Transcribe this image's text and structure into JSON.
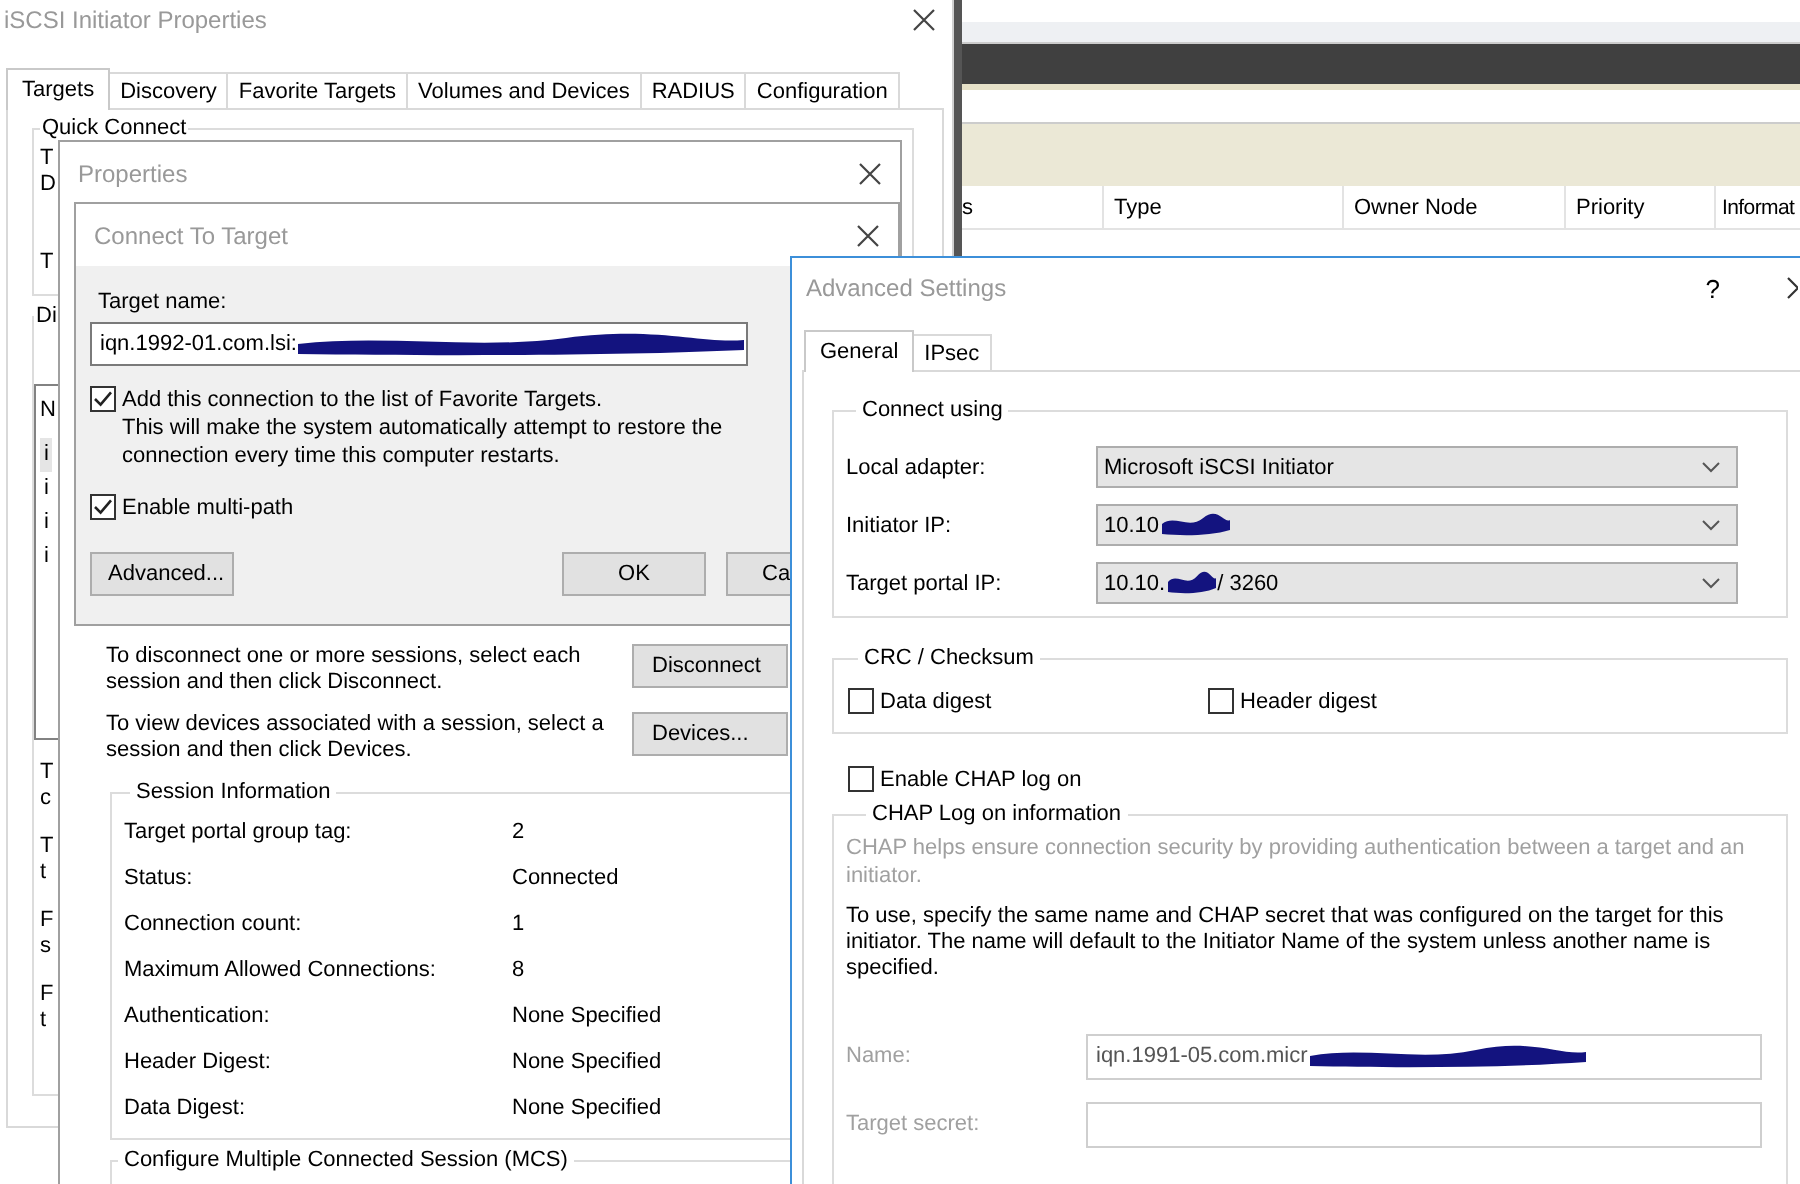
{
  "background_window": {
    "columns": [
      "s",
      "Type",
      "Owner Node",
      "Priority",
      "Informat"
    ]
  },
  "iscsi_window": {
    "title": "iSCSI Initiator Properties",
    "tabs": [
      {
        "label": "Targets",
        "selected": true
      },
      {
        "label": "Discovery",
        "selected": false
      },
      {
        "label": "Favorite Targets",
        "selected": false
      },
      {
        "label": "Volumes and Devices",
        "selected": false
      },
      {
        "label": "RADIUS",
        "selected": false
      },
      {
        "label": "Configuration",
        "selected": false
      }
    ],
    "quick_connect": {
      "label": "Quick Connect",
      "paragraphs": [
        [
          "T",
          "D"
        ],
        [
          "T"
        ]
      ]
    },
    "discovered": {
      "label": "Di",
      "list_header": "N",
      "rows": [
        {
          "text": "i",
          "selected": true
        },
        {
          "text": "i",
          "selected": false
        },
        {
          "text": "i",
          "selected": false
        },
        {
          "text": "i",
          "selected": false
        }
      ],
      "paragraphs": [
        [
          "T",
          "c"
        ],
        [
          "T",
          "t"
        ],
        [
          "F",
          "s"
        ],
        [
          "F",
          "t"
        ]
      ]
    }
  },
  "properties_window": {
    "title": "Properties",
    "actions": [
      {
        "text": "To disconnect one or more sessions, select each session and then click Disconnect.",
        "button": "Disconnect"
      },
      {
        "text": "To view devices associated with a session, select a session and then click Devices.",
        "button": "Devices..."
      }
    ],
    "session_info": {
      "label": "Session Information",
      "rows": [
        {
          "label": "Target portal group tag:",
          "value": "2"
        },
        {
          "label": "Status:",
          "value": "Connected"
        },
        {
          "label": "Connection count:",
          "value": "1"
        },
        {
          "label": "Maximum Allowed Connections:",
          "value": "8"
        },
        {
          "label": "Authentication:",
          "value": "None Specified"
        },
        {
          "label": "Header Digest:",
          "value": "None Specified"
        },
        {
          "label": "Data Digest:",
          "value": "None Specified"
        }
      ]
    },
    "mcs_label": "Configure Multiple Connected Session (MCS)"
  },
  "connect_window": {
    "title": "Connect To Target",
    "target_label": "Target name:",
    "target_value": "iqn.1992-01.com.lsi:",
    "target_redacted": true,
    "favorite": {
      "label": "Add this connection to the list of Favorite Targets.",
      "description": "This will make the system automatically attempt to restore the connection every time this computer restarts.",
      "checked": true
    },
    "multipath": {
      "label": "Enable multi-path",
      "checked": true
    },
    "buttons": [
      "Advanced...",
      "OK",
      "Ca"
    ]
  },
  "advanced_window": {
    "title": "Advanced Settings",
    "help": "?",
    "tabs": [
      {
        "label": "General",
        "selected": true
      },
      {
        "label": "IPsec",
        "selected": false
      }
    ],
    "connect_using": {
      "label": "Connect using",
      "fields": [
        {
          "label": "Local adapter:",
          "value": "Microsoft iSCSI Initiator",
          "redacted": false
        },
        {
          "label": "Initiator IP:",
          "value": "10.10",
          "redacted": true
        },
        {
          "label": "Target portal IP:",
          "value": "10.10.",
          "redacted": true,
          "value_end": "/ 3260"
        }
      ]
    },
    "crc": {
      "label": "CRC / Checksum",
      "options": [
        {
          "label": "Data digest",
          "checked": false
        },
        {
          "label": "Header digest",
          "checked": false
        }
      ]
    },
    "chap_enable": {
      "label": "Enable CHAP log on",
      "checked": false
    },
    "chap": {
      "label": "CHAP Log on information",
      "disabled": true,
      "note": "CHAP helps ensure connection security by providing authentication between a target and an initiator.",
      "instructions": "To use, specify the same name and CHAP secret that was configured on the target for this initiator.  The name will default to the Initiator Name of the system unless another name is specified.",
      "fields": [
        {
          "label": "Name:",
          "value": "iqn.1991-05.com.micr",
          "redacted": true
        },
        {
          "label": "Target secret:"
        }
      ]
    }
  }
}
